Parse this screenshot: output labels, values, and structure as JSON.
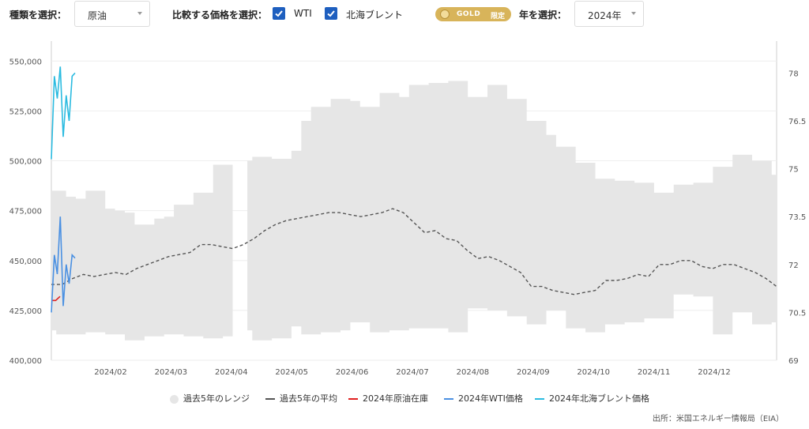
{
  "controls": {
    "type_label": "種類を選択：",
    "type_value": "原油",
    "compare_label": "比較する価格を選択：",
    "checkboxes": [
      {
        "label": "WTI",
        "checked": true
      },
      {
        "label": "北海ブレント",
        "checked": true
      }
    ],
    "gold_badge": {
      "text": "GOLD",
      "tag": "限定"
    },
    "year_label": "年を選択：",
    "year_value": "2024年"
  },
  "legend": [
    {
      "label": "過去5年のレンジ",
      "color": "#e6e6e6",
      "style": "dot"
    },
    {
      "label": "過去5年の平均",
      "color": "#555555",
      "style": "dash"
    },
    {
      "label": "2024年原油在庫",
      "color": "#e02020",
      "style": "line"
    },
    {
      "label": "2024年WTI価格",
      "color": "#4a90e2",
      "style": "line"
    },
    {
      "label": "2024年北海ブレント価格",
      "color": "#2bbbe0",
      "style": "line"
    }
  ],
  "source": "出所：米国エネルギー情報局（EIA）",
  "chart_data": {
    "type": "line",
    "x_ticks": [
      "2024/02",
      "2024/03",
      "2024/04",
      "2024/05",
      "2024/06",
      "2024/07",
      "2024/08",
      "2024/09",
      "2024/10",
      "2024/11",
      "2024/12"
    ],
    "y_left": {
      "ticks": [
        "400,000",
        "425,000",
        "450,000",
        "475,000",
        "500,000",
        "525,000",
        "550,000"
      ],
      "range": [
        400000,
        560000
      ]
    },
    "y_right": {
      "ticks": [
        "69",
        "70.5",
        "72",
        "73.5",
        "75",
        "76.5",
        "78"
      ],
      "range": [
        69,
        79
      ]
    },
    "weeks": 52,
    "range_high": [
      485000,
      485000,
      482000,
      481000,
      485000,
      485000,
      476000,
      475000,
      474000,
      468000,
      468000,
      471000,
      472000,
      478000,
      478000,
      484000,
      484000,
      498000,
      498000,
      null,
      500000,
      502000,
      502000,
      501000,
      501000,
      505000,
      520000,
      527000,
      527000,
      531000,
      531000,
      530000,
      527000,
      527000,
      534000,
      534000,
      532000,
      538000,
      538000,
      539000,
      539000,
      540000,
      540000,
      532000,
      532000,
      538000,
      538000,
      531000,
      531000,
      520000,
      520000,
      513000,
      507000,
      507000,
      499000,
      499000,
      491000,
      491000,
      490000,
      490000,
      489000,
      489000,
      484000,
      484000,
      488000,
      488000,
      489000,
      489000,
      497000,
      497000,
      503000,
      503000,
      500000,
      500000,
      493000
    ],
    "range_low": [
      415000,
      413000,
      413000,
      413000,
      414000,
      414000,
      413000,
      413000,
      410000,
      410000,
      412000,
      412000,
      413000,
      413000,
      412000,
      412000,
      411000,
      411000,
      412000,
      null,
      415000,
      410000,
      410000,
      411000,
      411000,
      417000,
      413000,
      413000,
      414000,
      414000,
      415000,
      419000,
      419000,
      414000,
      414000,
      415000,
      415000,
      416000,
      416000,
      416000,
      416000,
      414000,
      414000,
      426000,
      426000,
      425000,
      425000,
      422000,
      422000,
      418000,
      418000,
      425000,
      425000,
      416000,
      416000,
      414000,
      414000,
      418000,
      418000,
      419000,
      419000,
      421000,
      421000,
      421000,
      433000,
      433000,
      432000,
      432000,
      413000,
      413000,
      424000,
      424000,
      418000,
      418000,
      419000
    ],
    "series": [
      {
        "name": "過去5年の平均",
        "axis": "left",
        "values": [
          438000,
          438000,
          441000,
          443000,
          442000,
          443000,
          444000,
          443000,
          446000,
          448000,
          450000,
          452000,
          453000,
          454000,
          458000,
          458000,
          457000,
          456000,
          458000,
          461000,
          465000,
          468000,
          470000,
          471000,
          472000,
          473000,
          474000,
          474000,
          473000,
          472000,
          473000,
          474000,
          476000,
          474000,
          469000,
          464000,
          465000,
          461000,
          460000,
          455000,
          451000,
          452000,
          450000,
          447000,
          444000,
          437000,
          437000,
          435000,
          434000,
          433000,
          434000,
          435000,
          440000,
          440000,
          441000,
          443000,
          442000,
          448000,
          448000,
          450000,
          450000,
          447000,
          446000,
          448000,
          448000,
          446000,
          444000,
          441000,
          437000
        ]
      },
      {
        "name": "2024年原油在庫",
        "axis": "left",
        "values": [
          430000,
          430000,
          432000
        ]
      },
      {
        "name": "2024年WTI価格",
        "axis": "right",
        "values": [
          70.5,
          72.3,
          71.7,
          73.5,
          70.7,
          72.0,
          71.4,
          72.3,
          72.2
        ]
      },
      {
        "name": "2024年北海ブレント価格",
        "axis": "right",
        "values": [
          75.3,
          77.9,
          77.2,
          78.2,
          76.0,
          77.3,
          76.5,
          77.9,
          78.0
        ]
      }
    ]
  }
}
